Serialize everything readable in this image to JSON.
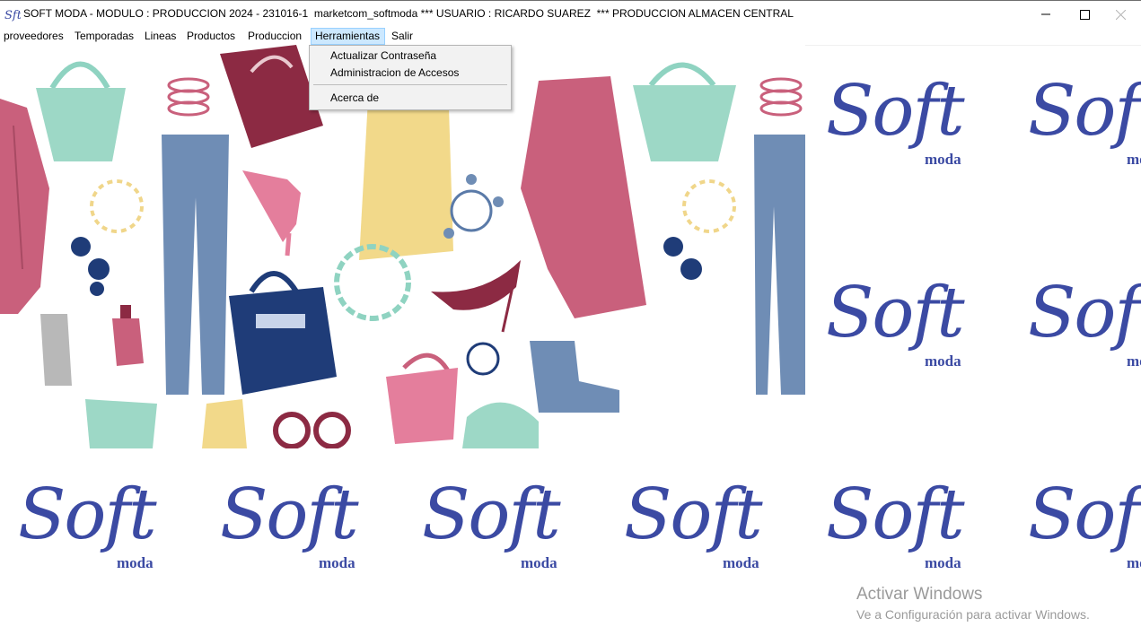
{
  "window": {
    "title": "SOFT MODA - MODULO : PRODUCCION 2024 - 231016-1  marketcom_softmoda *** USUARIO : RICARDO SUAREZ  *** PRODUCCION ALMACEN CENTRAL",
    "controls": [
      "minimize-icon",
      "maximize-icon",
      "close-icon"
    ]
  },
  "menu": {
    "items": [
      {
        "label": "proveedores"
      },
      {
        "label": "Temporadas"
      },
      {
        "label": "Lineas"
      },
      {
        "label": "Productos"
      },
      {
        "label": "Produccion"
      },
      {
        "label": "Herramientas",
        "active": true
      },
      {
        "label": "Salir"
      }
    ]
  },
  "dropdown": {
    "items": [
      {
        "label": "Actualizar Contraseña"
      },
      {
        "label": "Administracion de Accesos"
      },
      {
        "label": "Acerca de"
      }
    ]
  },
  "logo": {
    "word": "Soft",
    "sub": "moda",
    "color": "#3b4aa3"
  },
  "watermark": {
    "title": "Activar Windows",
    "subtitle": "Ve a Configuración para activar Windows."
  },
  "colors": {
    "menu_highlight": "#cce8ff",
    "menu_highlight_border": "#99d1ff",
    "dropdown_bg": "#f2f2f2"
  }
}
